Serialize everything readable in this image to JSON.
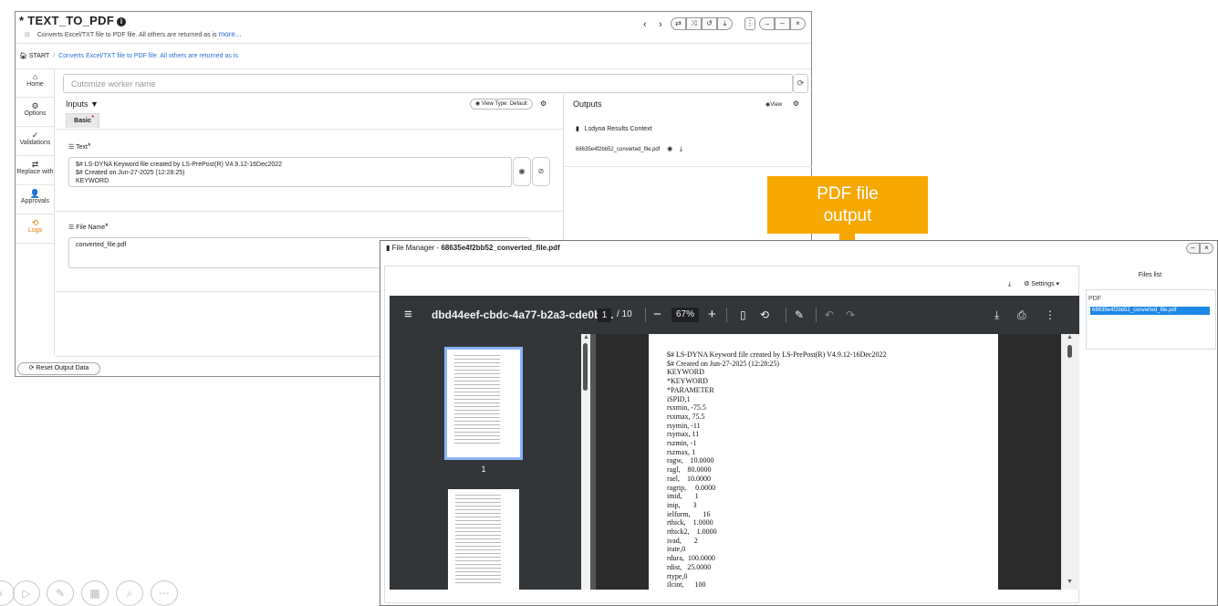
{
  "worker": {
    "title": "* TEXT_TO_PDF",
    "info_icon": "i",
    "subtitle": "Converts Excel/TXT file to PDF file. All others are returned as is",
    "more_link": "more...",
    "nav_prev": "‹",
    "nav_next": "›",
    "toolbar_icons": [
      "swap-icon",
      "shuffle-icon",
      "undo-icon",
      "download-icon",
      "more-vert-icon",
      "arrow-right-icon",
      "minimize-icon",
      "close-icon"
    ],
    "breadcrumb": {
      "home": "START",
      "current": "Converts Excel/TXT file to PDF file. All others are returned as is"
    },
    "sidebar": [
      {
        "icon": "home-icon",
        "glyph": "⌂",
        "label": "Home"
      },
      {
        "icon": "gear-icon",
        "glyph": "⚙",
        "label": "Options"
      },
      {
        "icon": "check-icon",
        "glyph": "✓",
        "label": "Validations"
      },
      {
        "icon": "swap-icon",
        "glyph": "⇄",
        "label": "Replace with"
      },
      {
        "icon": "approval-icon",
        "glyph": "👤",
        "label": "Approvals"
      },
      {
        "icon": "logs-icon",
        "glyph": "⟲",
        "label": "Logs"
      }
    ],
    "worker_name_placeholder": "Cutomize worker name",
    "inputs": {
      "title": "Inputs",
      "view_type": "View Type: Default",
      "tab": "Basic",
      "text_label": "Text",
      "text_value": [
        "$# LS-DYNA Keyword file created by LS-PrePost(R) V4.9.12-16Dec2022",
        "$# Created on Jun-27-2025 (12:28:25)",
        "KEYWORD"
      ],
      "filename_label": "File Name",
      "filename_value": "converted_file.pdf"
    },
    "outputs": {
      "title": "Outputs",
      "view_button": "View",
      "context": "Lsdyna Results Context",
      "file": "68635e4f2bb52_converted_file.pdf"
    },
    "reset_button": "Reset Output Data"
  },
  "callout": {
    "line1": "PDF file",
    "line2": "output",
    "color": "#f6a800"
  },
  "file_manager": {
    "title_prefix": "File Manager -",
    "title_file": "68635e4f2bb52_converted_file.pdf",
    "settings_label": "Settings",
    "files_list_title": "Files list",
    "group": "PDF",
    "selected_file": "68635e4f2bb52_converted_file.pdf",
    "viewer": {
      "doc_title": "dbd44eef-cbdc-4a77-b2a3-cde0bf...",
      "page": "1",
      "page_total": "/ 10",
      "zoom": "67%",
      "thumb_page": "1",
      "lines": [
        "$# LS-DYNA Keyword file created by LS-PrePost(R) V4.9.12-16Dec2022",
        "$# Created on Jun-27-2025 (12:28:25)",
        "KEYWORD",
        "*KEYWORD",
        "*PARAMETER",
        "iSPID,1",
        "rsxmin, -75.5",
        "rsxmax, 75.5",
        "rsymin, -11",
        "rsymax, 11",
        "rszmin, -1",
        "rszmax, 1",
        "ragw,    10.0000",
        "ragl,    80.0000",
        "rael,    10.0000",
        "ragrip,     0.0000",
        "imid,       1",
        "inip,       3",
        "ielform,       16",
        "rthick,    1.0000",
        "rthick2,    1.0000",
        "ivad,       2",
        "irate,0",
        "rdura,  100.0000",
        "rdist,   25.0000",
        "rtype,0",
        "ilcint,      100"
      ]
    }
  },
  "ghost_controls": [
    "back-icon",
    "play-icon",
    "pen-icon",
    "slides-icon",
    "zoom-icon",
    "more-icon"
  ]
}
